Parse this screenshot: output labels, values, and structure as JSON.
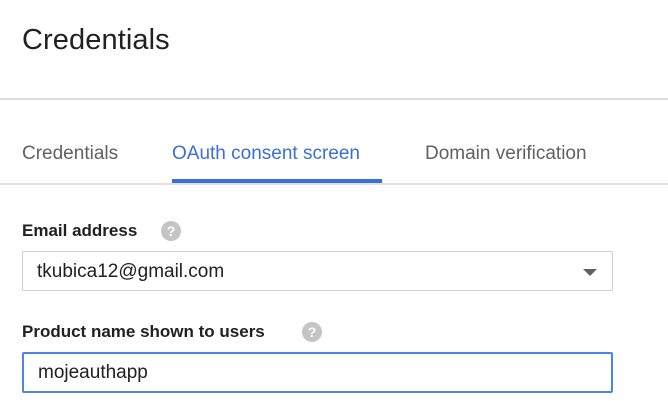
{
  "header": {
    "title": "Credentials"
  },
  "tabs": [
    {
      "label": "Credentials",
      "active": false
    },
    {
      "label": "OAuth consent screen",
      "active": true
    },
    {
      "label": "Domain verification",
      "active": false
    }
  ],
  "form": {
    "email": {
      "label": "Email address",
      "help_icon": "help-icon",
      "selected_value": "tkubica12@gmail.com",
      "dropdown_icon": "chevron-down-icon"
    },
    "product_name": {
      "label": "Product name shown to users",
      "help_icon": "help-icon",
      "value": "mojeauthapp"
    }
  },
  "colors": {
    "accent": "#3b6fd4",
    "focus_border": "#4a86e8",
    "help_icon": "#c4c4c4"
  }
}
